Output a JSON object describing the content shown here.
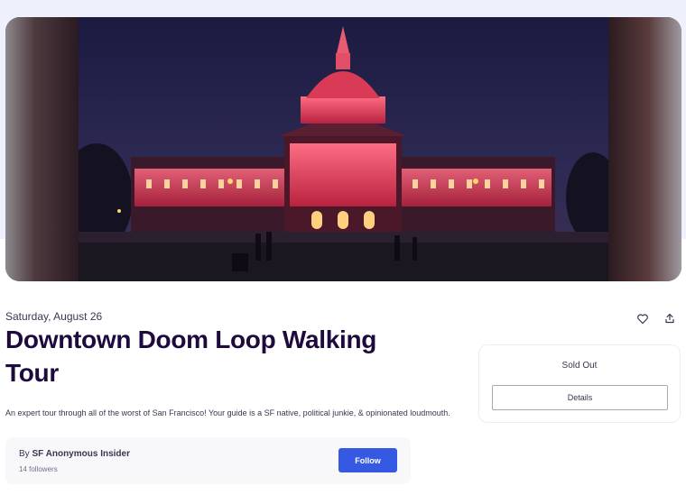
{
  "event": {
    "date": "Saturday, August 26",
    "title": "Downtown Doom Loop Walking Tour",
    "description": "An expert tour through all of the worst of San Francisco! Your guide is a SF native, political junkie, & opinionated loudmouth."
  },
  "actions": {
    "like_icon": "heart-icon",
    "share_icon": "share-icon"
  },
  "ticket": {
    "status": "Sold Out",
    "details_label": "Details"
  },
  "organizer": {
    "by_label": "By",
    "name": "SF Anonymous Insider",
    "followers": "14 followers",
    "follow_label": "Follow"
  },
  "colors": {
    "accent": "#3659e3",
    "title": "#1e0a3c",
    "hero_building_light": "#e4405a"
  }
}
